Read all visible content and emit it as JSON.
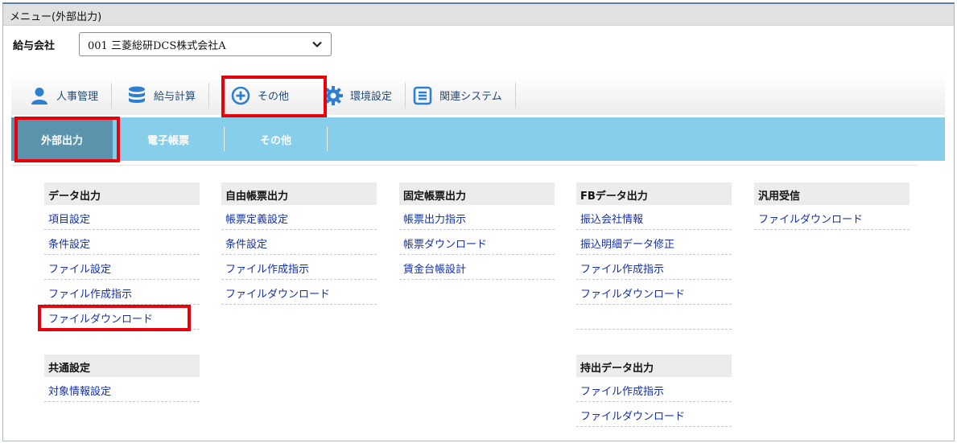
{
  "window": {
    "title": "メニュー(外部出力)"
  },
  "company": {
    "label": "給与会社",
    "selected": "001 三菱総研DCS株式会社A"
  },
  "tabs": [
    {
      "label": "人事管理",
      "icon": "person-icon"
    },
    {
      "label": "給与計算",
      "icon": "database-icon"
    },
    {
      "label": "その他",
      "icon": "plus-circle-icon"
    },
    {
      "label": "環境設定",
      "icon": "gear-icon"
    },
    {
      "label": "関連システム",
      "icon": "list-icon"
    }
  ],
  "subtabs": [
    {
      "label": "外部出力"
    },
    {
      "label": "電子帳票"
    },
    {
      "label": "その他"
    }
  ],
  "columns": [
    {
      "sections": [
        {
          "title": "データ出力",
          "items": [
            "項目設定",
            "条件設定",
            "ファイル設定",
            "ファイル作成指示",
            "ファイルダウンロード"
          ]
        },
        {
          "title": "共通設定",
          "items": [
            "対象情報設定"
          ]
        }
      ]
    },
    {
      "sections": [
        {
          "title": "自由帳票出力",
          "items": [
            "帳票定義設定",
            "条件設定",
            "ファイル作成指示",
            "ファイルダウンロード"
          ]
        }
      ]
    },
    {
      "sections": [
        {
          "title": "固定帳票出力",
          "items": [
            "帳票出力指示",
            "帳票ダウンロード",
            "賃金台帳設計"
          ]
        }
      ]
    },
    {
      "sections": [
        {
          "title": "FBデータ出力",
          "items": [
            "振込会社情報",
            "振込明細データ修正",
            "ファイル作成指示",
            "ファイルダウンロード"
          ]
        },
        {
          "title": "持出データ出力",
          "items": [
            "ファイル作成指示",
            "ファイルダウンロード"
          ]
        }
      ]
    },
    {
      "sections": [
        {
          "title": "汎用受信",
          "items": [
            "ファイルダウンロード"
          ]
        }
      ]
    }
  ]
}
